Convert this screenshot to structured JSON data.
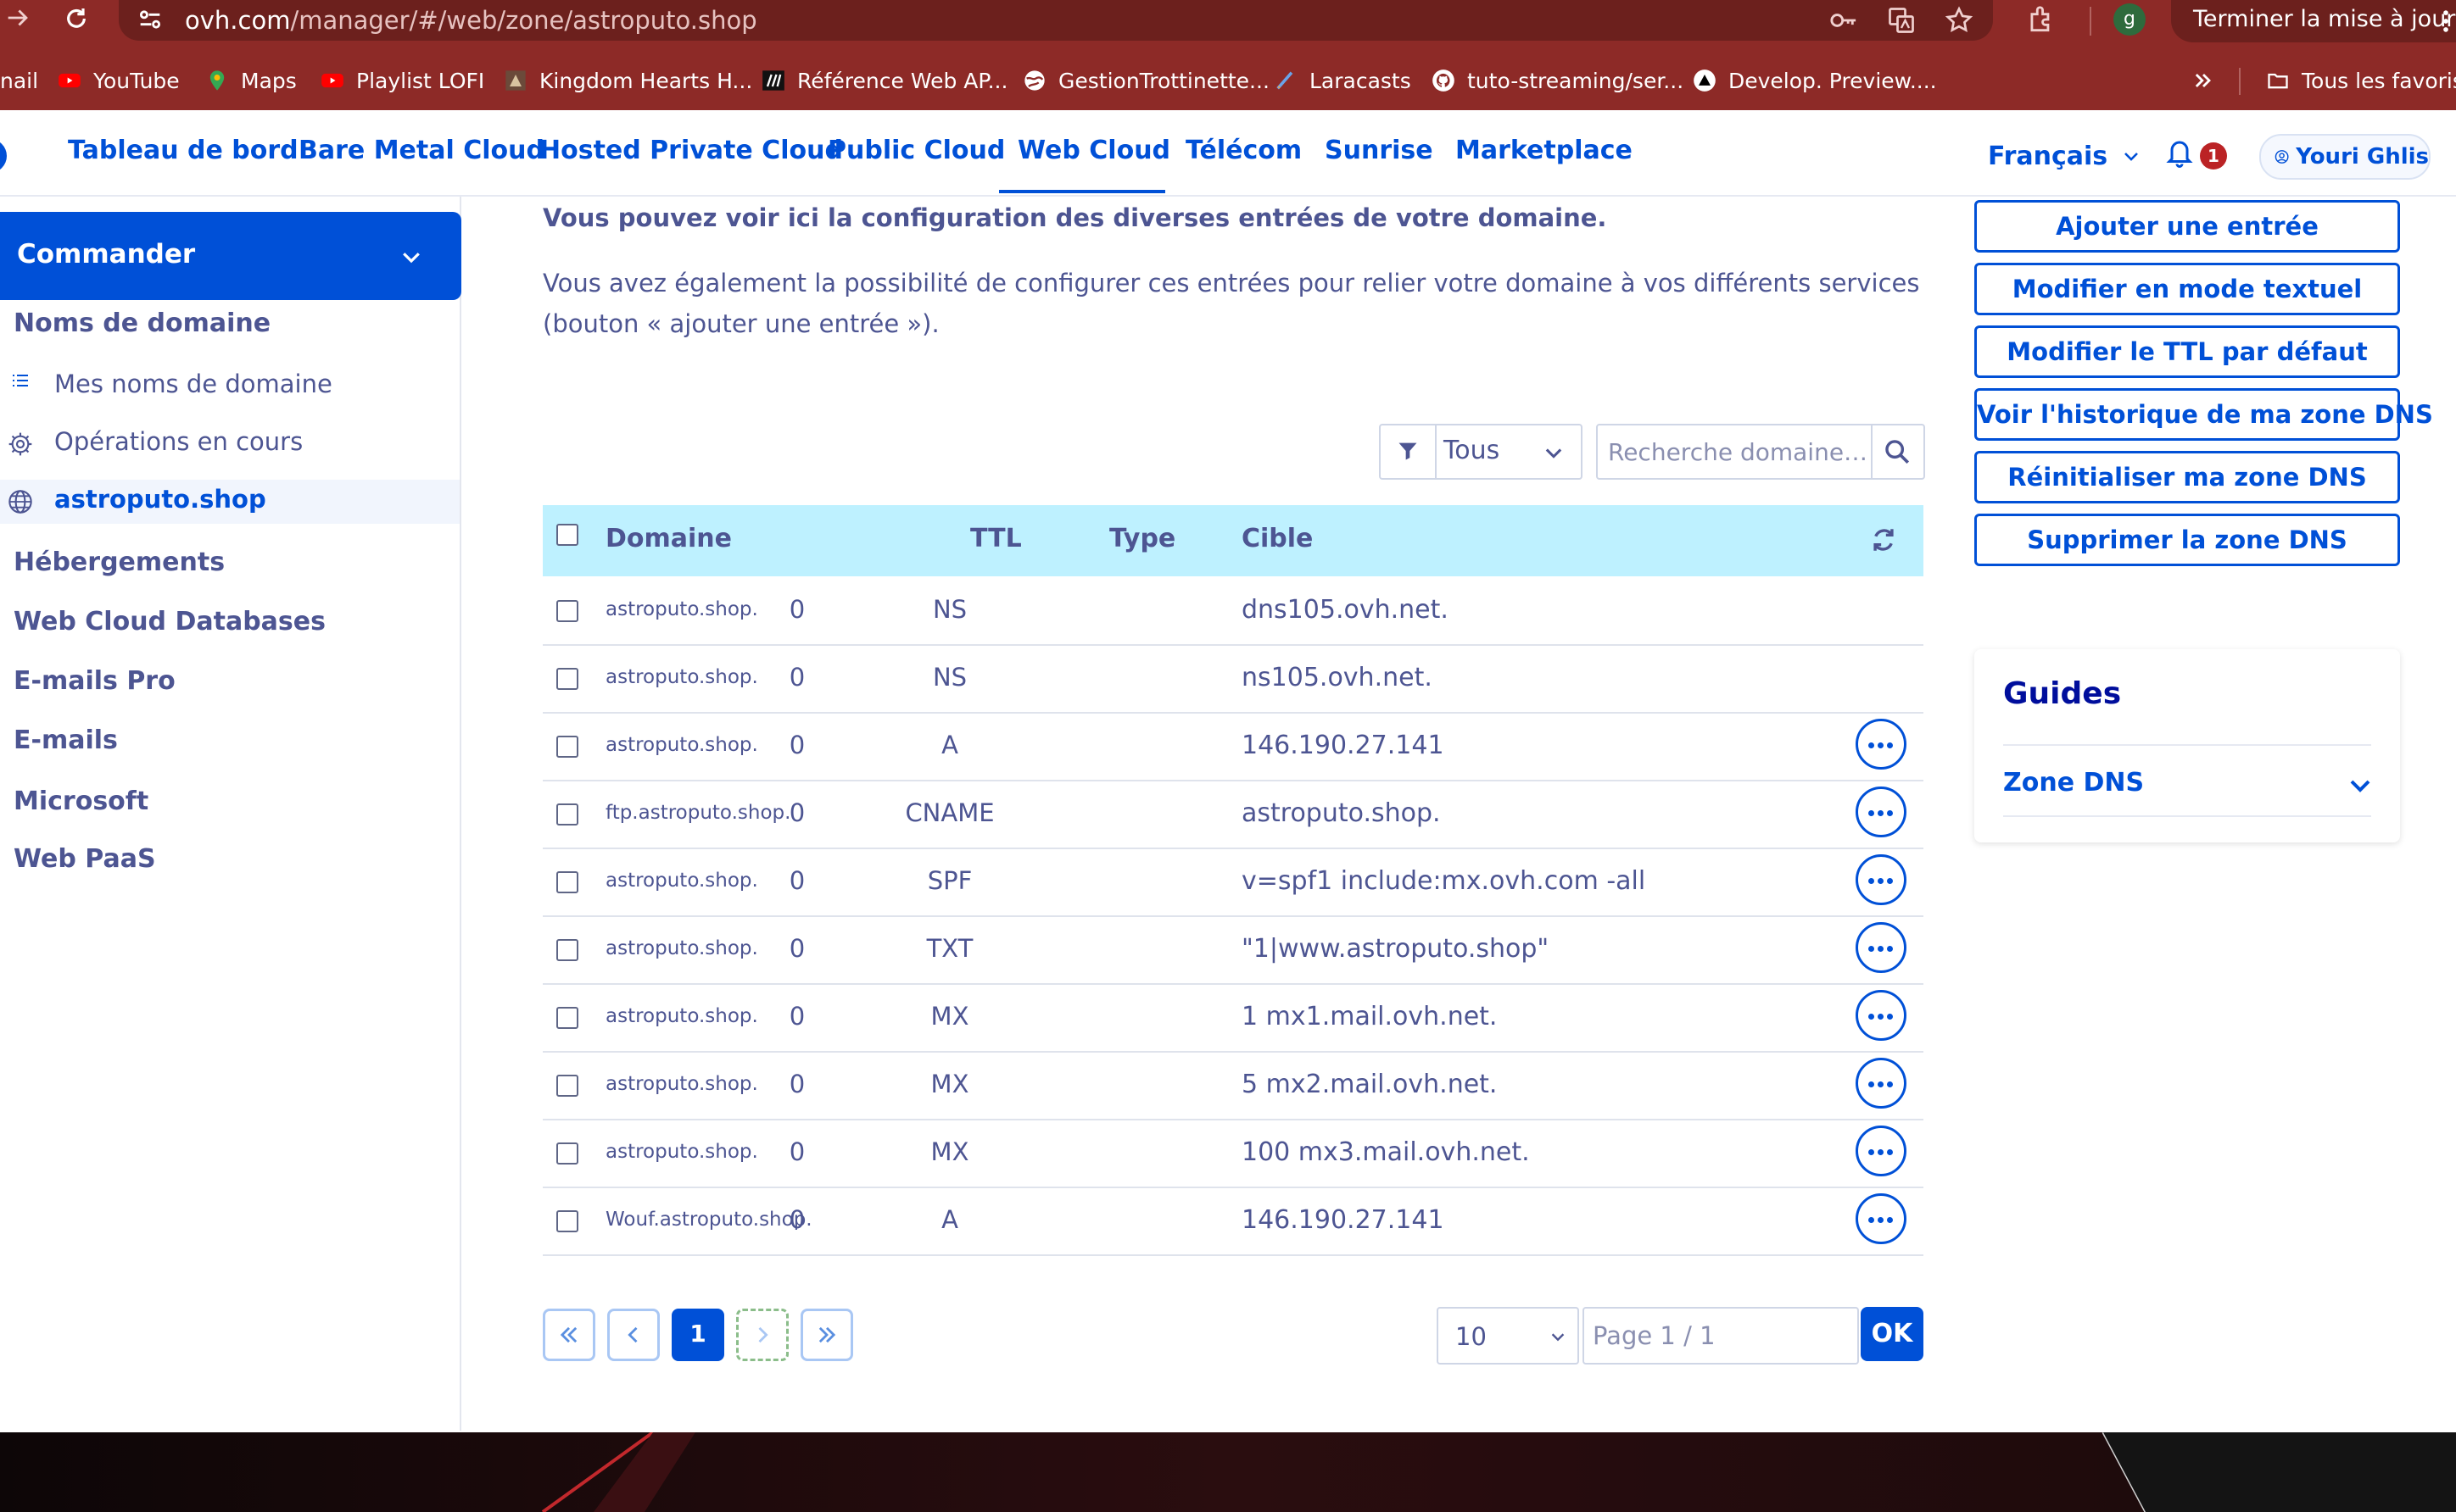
{
  "browser": {
    "url_host": "ovh.com",
    "url_path": "/manager/#/web/zone/astroputo.shop",
    "update_label": "Terminer la mise à jour",
    "profile_initial": "g",
    "bookmarks": [
      {
        "label": "nail"
      },
      {
        "label": "YouTube"
      },
      {
        "label": "Maps"
      },
      {
        "label": "Playlist LOFI"
      },
      {
        "label": "Kingdom Hearts H..."
      },
      {
        "label": "Référence Web AP..."
      },
      {
        "label": "GestionTrottinette..."
      },
      {
        "label": "Laracasts"
      },
      {
        "label": "tuto-streaming/ser..."
      },
      {
        "label": "Develop. Preview...."
      }
    ],
    "all_bookmarks_label": "Tous les favoris"
  },
  "nav": {
    "tabs": [
      "Tableau de bord",
      "Bare Metal Cloud",
      "Hosted Private Cloud",
      "Public Cloud",
      "Web Cloud",
      "Télécom",
      "Sunrise",
      "Marketplace"
    ],
    "active_tab": "Web Cloud",
    "language": "Français",
    "notification_count": "1",
    "user_name": "Youri Ghlis"
  },
  "sidebar": {
    "order_button": "Commander",
    "domain_section": "Noms de domaine",
    "items": [
      {
        "label": "Mes noms de domaine",
        "icon": "list-icon"
      },
      {
        "label": "Opérations en cours",
        "icon": "gear-icon"
      },
      {
        "label": "astroputo.shop",
        "icon": "globe-icon",
        "active": true
      }
    ],
    "sections": [
      "Hébergements",
      "Web Cloud Databases",
      "E-mails Pro",
      "E-mails",
      "Microsoft",
      "Web PaaS"
    ]
  },
  "main": {
    "intro_bold": "Vous pouvez voir ici la configuration des diverses entrées de votre domaine.",
    "intro_text": "Vous avez également la possibilité de configurer ces entrées pour relier votre domaine à vos différents services (bouton « ajouter une entrée »).",
    "filter_value": "Tous",
    "search_placeholder": "Recherche domaine…",
    "columns": {
      "domain": "Domaine",
      "ttl": "TTL",
      "type": "Type",
      "target": "Cible"
    },
    "rows": [
      {
        "domain": "astroputo.shop.",
        "ttl": "0",
        "type": "NS",
        "target": "dns105.ovh.net.",
        "actions": false
      },
      {
        "domain": "astroputo.shop.",
        "ttl": "0",
        "type": "NS",
        "target": "ns105.ovh.net.",
        "actions": false
      },
      {
        "domain": "astroputo.shop.",
        "ttl": "0",
        "type": "A",
        "target": "146.190.27.141",
        "actions": true
      },
      {
        "domain": "ftp.astroputo.shop.",
        "ttl": "0",
        "type": "CNAME",
        "target": "astroputo.shop.",
        "actions": true
      },
      {
        "domain": "astroputo.shop.",
        "ttl": "0",
        "type": "SPF",
        "target": "v=spf1 include:mx.ovh.com -all",
        "actions": true
      },
      {
        "domain": "astroputo.shop.",
        "ttl": "0",
        "type": "TXT",
        "target": "\"1|www.astroputo.shop\"",
        "actions": true
      },
      {
        "domain": "astroputo.shop.",
        "ttl": "0",
        "type": "MX",
        "target": "1 mx1.mail.ovh.net.",
        "actions": true
      },
      {
        "domain": "astroputo.shop.",
        "ttl": "0",
        "type": "MX",
        "target": "5 mx2.mail.ovh.net.",
        "actions": true
      },
      {
        "domain": "astroputo.shop.",
        "ttl": "0",
        "type": "MX",
        "target": "100 mx3.mail.ovh.net.",
        "actions": true
      },
      {
        "domain": "Wouf.astroputo.shop.",
        "ttl": "0",
        "type": "A",
        "target": "146.190.27.141",
        "actions": true
      }
    ],
    "pagination": {
      "current_page": "1",
      "page_size": "10",
      "page_placeholder": "Page 1 / 1",
      "ok_label": "OK"
    }
  },
  "actions": [
    "Ajouter une entrée",
    "Modifier en mode textuel",
    "Modifier le TTL par défaut",
    "Voir l'historique de ma zone DNS",
    "Réinitialiser ma zone DNS",
    "Supprimer la zone DNS"
  ],
  "guides": {
    "title": "Guides",
    "link": "Zone DNS"
  },
  "colors": {
    "brand_blue": "#0050d7",
    "text": "#4d5592",
    "table_header": "#bef1ff",
    "browser_chrome": "#8d2a27"
  }
}
